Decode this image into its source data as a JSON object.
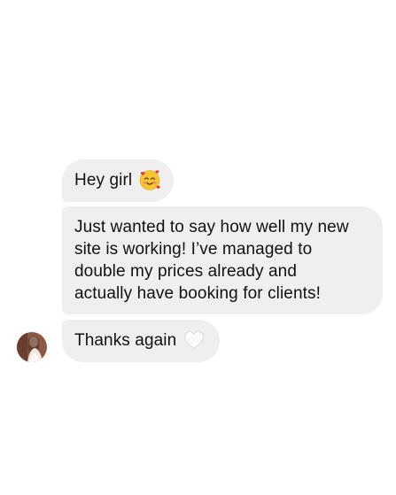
{
  "chat": {
    "messages": [
      {
        "text": "Hey girl",
        "emoji": "smiling-face-with-hearts-icon"
      },
      {
        "lines": [
          "Just wanted to say how well my new",
          "site is working! I’ve managed to",
          "double my prices already and",
          "actually have booking for clients!"
        ]
      },
      {
        "text": "Thanks again",
        "emoji": "white-heart-icon"
      }
    ],
    "sender_avatar": "avatar-photo"
  },
  "colors": {
    "bubble": "#efefef",
    "text": "#111111",
    "background": "#ffffff"
  }
}
